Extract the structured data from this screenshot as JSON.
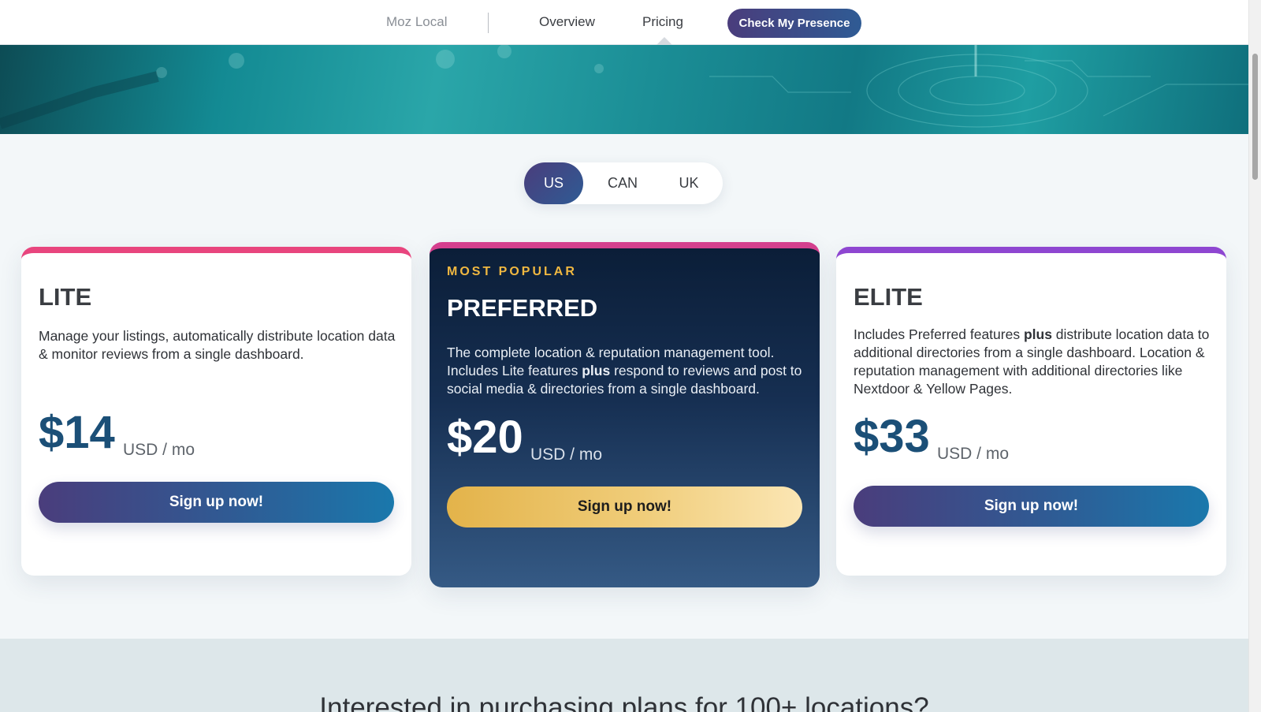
{
  "nav": {
    "brand": "Moz Local",
    "links": [
      "Overview",
      "Pricing"
    ],
    "cta": "Check My Presence"
  },
  "region_toggle": {
    "options": [
      "US",
      "CAN",
      "UK"
    ],
    "selected": "US"
  },
  "plans": [
    {
      "name": "LITE",
      "desc": "Manage your listings, automatically distribute location data & monitor reviews from a single dashboard.",
      "price": "$14",
      "unit": "USD / mo",
      "cta": "Sign up now!",
      "accent": "#e8457e"
    },
    {
      "badge": "MOST POPULAR",
      "name": "PREFERRED",
      "desc_parts": [
        "The complete location & reputation management tool. Includes Lite features ",
        "plus",
        " respond to reviews and post to social media & directories from a single dashboard."
      ],
      "price": "$20",
      "unit": "USD / mo",
      "cta": "Sign up now!",
      "accent": "#d43f8e"
    },
    {
      "name": "ELITE",
      "desc_parts": [
        "Includes Preferred features ",
        "plus",
        " distribute location data to additional directories from a single dashboard. Location & reputation management with additional directories like Nextdoor & Yellow Pages."
      ],
      "price": "$33",
      "unit": "USD / mo",
      "cta": "Sign up now!",
      "accent": "#8e46d1"
    }
  ],
  "bottom": {
    "heading": "Interested in purchasing plans for 100+ locations?"
  },
  "colors": {
    "brand_gradient_start": "#4a3d7c",
    "brand_gradient_end": "#2f5b94",
    "price_blue": "#1b4f77",
    "gold": "#f0b841"
  }
}
